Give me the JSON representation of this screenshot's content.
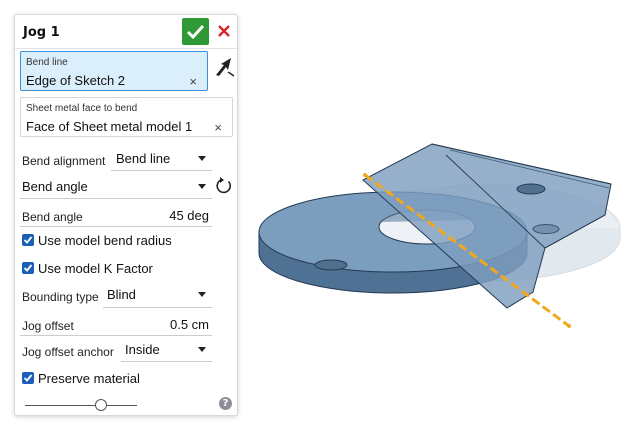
{
  "dialog": {
    "title": "Jog 1",
    "bend_line": {
      "label": "Bend line",
      "value": "Edge of Sketch 2",
      "clear": "×"
    },
    "face_to_bend": {
      "label": "Sheet metal face to bend",
      "value": "Face of Sheet metal model 1",
      "clear": "×"
    },
    "bend_alignment": {
      "label": "Bend alignment",
      "value": "Bend line"
    },
    "bend_mode": {
      "value": "Bend angle"
    },
    "bend_angle": {
      "label": "Bend angle",
      "value": "45 deg"
    },
    "use_model_bend_radius": {
      "label": "Use model bend radius",
      "checked": true
    },
    "use_model_k_factor": {
      "label": "Use model K Factor",
      "checked": true
    },
    "bounding_type": {
      "label": "Bounding type",
      "value": "Blind"
    },
    "jog_offset": {
      "label": "Jog offset",
      "value": "0.5 cm"
    },
    "jog_offset_anchor": {
      "label": "Jog offset anchor",
      "value": "Inside"
    },
    "preserve_material": {
      "label": "Preserve material",
      "checked": true
    },
    "help": "?"
  },
  "colors": {
    "accent_blue": "#1c5fb8",
    "active_field": "#dbeefb",
    "confirm_green": "#2f9a35",
    "cancel_red": "#d9262c",
    "part_blue": "#6f95b8",
    "bend_line_orange": "#f2a81d"
  },
  "icons": [
    "check-icon",
    "close-icon",
    "select-arrow-icon",
    "flip-direction-icon",
    "help-icon"
  ]
}
